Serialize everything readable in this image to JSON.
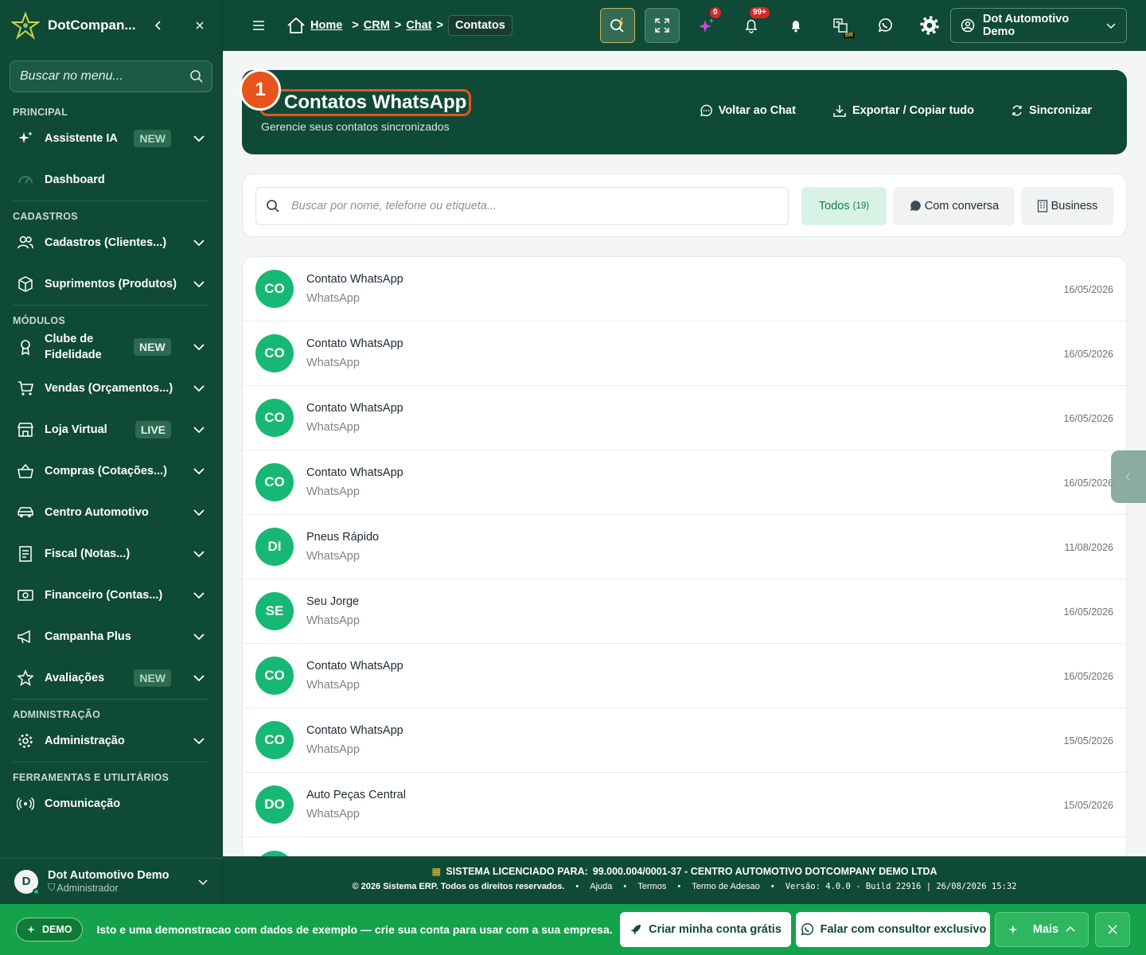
{
  "sidebar": {
    "brand": "DotCompan...",
    "search_placeholder": "Buscar no menu...",
    "sections": {
      "principal": "PRINCIPAL",
      "cadastros": "CADASTROS",
      "modulos": "MÓDULOS",
      "administracao": "ADMINISTRAÇÃO",
      "ferramentas": "FERRAMENTAS E UTILITÁRIOS"
    },
    "items": {
      "assistente": {
        "label": "Assistente IA",
        "badge": "NEW"
      },
      "dashboard": {
        "label": "Dashboard"
      },
      "cadastros": {
        "label": "Cadastros (Clientes...)"
      },
      "suprimentos": {
        "label": "Suprimentos (Produtos)"
      },
      "clube": {
        "label": "Clube de Fidelidade",
        "badge": "NEW"
      },
      "vendas": {
        "label": "Vendas (Orçamentos...)"
      },
      "loja": {
        "label": "Loja Virtual",
        "badge": "LIVE"
      },
      "compras": {
        "label": "Compras (Cotações...)"
      },
      "centro": {
        "label": "Centro Automotivo"
      },
      "fiscal": {
        "label": "Fiscal (Notas...)"
      },
      "financeiro": {
        "label": "Financeiro (Contas...)"
      },
      "campanha": {
        "label": "Campanha Plus"
      },
      "avaliacoes": {
        "label": "Avaliações",
        "badge": "NEW"
      },
      "administracao": {
        "label": "Administração"
      },
      "comunicacao": {
        "label": "Comunicação"
      }
    },
    "user": {
      "initial": "D",
      "name": "Dot Automotivo Demo",
      "role": "Administrador"
    }
  },
  "topbar": {
    "breadcrumb": {
      "home": "Home",
      "crm": "CRM",
      "chat": "Chat",
      "current": "Contatos"
    },
    "ai_count": "0",
    "notif_count": "99+",
    "lang": "BR",
    "account": "Dot Automotivo Demo"
  },
  "hero": {
    "step": "1",
    "title": "Contatos WhatsApp",
    "subtitle": "Gerencie seus contatos sincronizados",
    "actions": {
      "back": "Voltar ao Chat",
      "export": "Exportar / Copiar tudo",
      "sync": "Sincronizar"
    }
  },
  "filters": {
    "search_placeholder": "Buscar por nome, telefone ou etiqueta...",
    "all_label": "Todos",
    "all_count": "(19)",
    "conversation_label": "Com conversa",
    "business_label": "Business"
  },
  "contacts": [
    {
      "initials": "CO",
      "name": "Contato WhatsApp",
      "source": "WhatsApp",
      "date": "16/05/2026"
    },
    {
      "initials": "CO",
      "name": "Contato WhatsApp",
      "source": "WhatsApp",
      "date": "16/05/2026"
    },
    {
      "initials": "CO",
      "name": "Contato WhatsApp",
      "source": "WhatsApp",
      "date": "16/05/2026"
    },
    {
      "initials": "CO",
      "name": "Contato WhatsApp",
      "source": "WhatsApp",
      "date": "16/05/2026"
    },
    {
      "initials": "DI",
      "name": "Pneus Rápido",
      "source": "WhatsApp",
      "date": "11/08/2026"
    },
    {
      "initials": "SE",
      "name": "Seu Jorge",
      "source": "WhatsApp",
      "date": "16/05/2026"
    },
    {
      "initials": "CO",
      "name": "Contato WhatsApp",
      "source": "WhatsApp",
      "date": "16/05/2026"
    },
    {
      "initials": "CO",
      "name": "Contato WhatsApp",
      "source": "WhatsApp",
      "date": "15/05/2026"
    },
    {
      "initials": "DO",
      "name": "Auto Peças Central",
      "source": "WhatsApp",
      "date": "15/05/2026"
    }
  ],
  "footer": {
    "license_label": "SISTEMA LICENCIADO PARA:",
    "license_value": "99.000.004/0001-37 - CENTRO AUTOMOTIVO DOTCOMPANY DEMO LTDA",
    "copyright": "© 2026 Sistema ERP. Todos os direitos reservados.",
    "help": "Ajuda",
    "terms": "Termos",
    "adhesion": "Termo de Adesao",
    "version": "Versão: 4.0.0 - Build 22916 | 26/08/2026 15:32"
  },
  "demo": {
    "pill": "DEMO",
    "text": "Isto e uma demonstracao com dados de exemplo — crie sua conta para usar com a sua empresa.",
    "create": "Criar minha conta grátis",
    "consultant": "Falar com consultor exclusivo",
    "more": "Mais"
  },
  "colors": {
    "primary": "#0f4a36",
    "accent": "#17b873",
    "step": "#e8541c",
    "demo": "#14a34a"
  }
}
